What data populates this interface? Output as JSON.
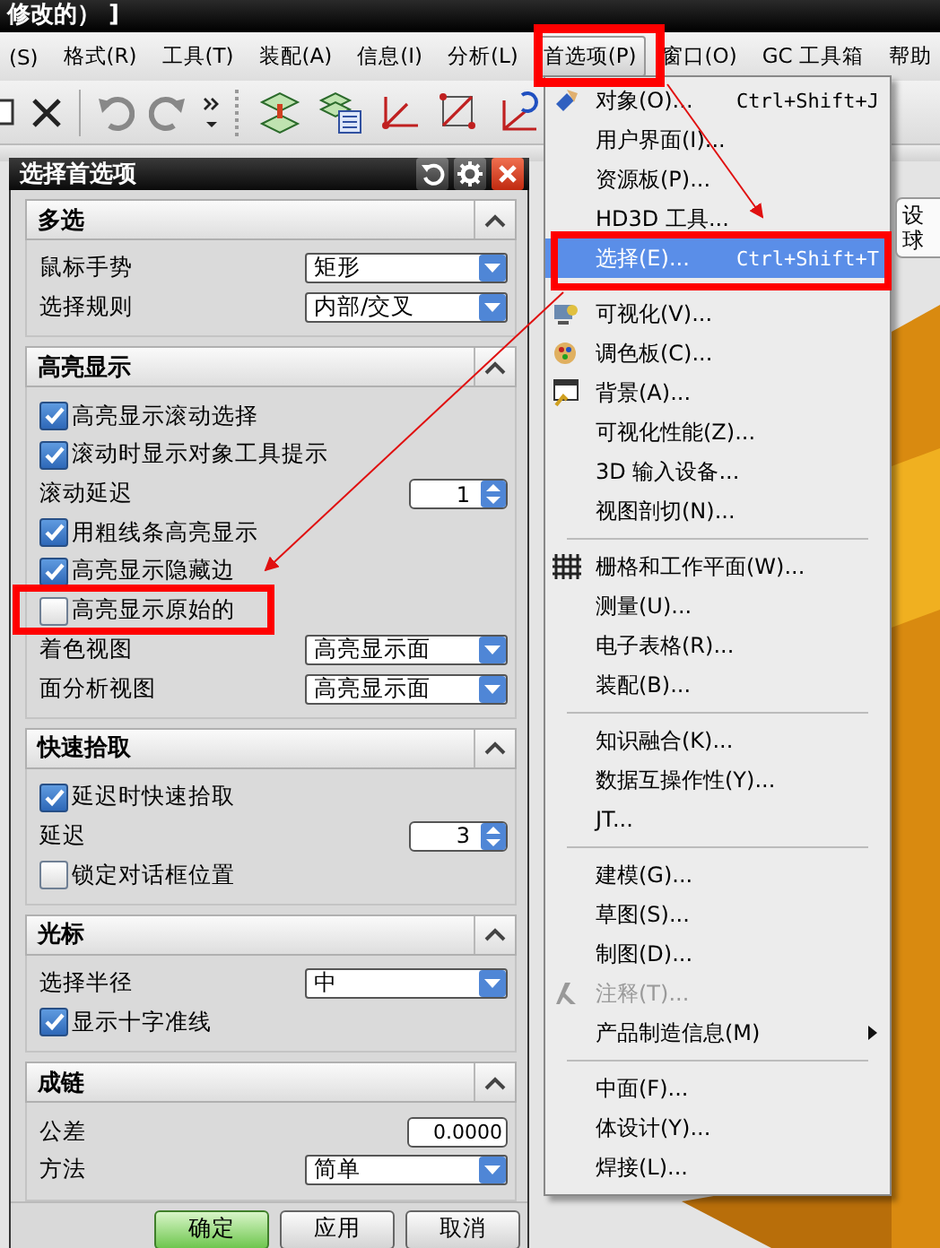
{
  "title_bar": {
    "title": "修改的） ]"
  },
  "menu_bar": [
    {
      "label": "(S)",
      "selected": false
    },
    {
      "label": "格式(R)",
      "selected": false
    },
    {
      "label": "工具(T)",
      "selected": false
    },
    {
      "label": "装配(A)",
      "selected": false
    },
    {
      "label": "信息(I)",
      "selected": false
    },
    {
      "label": "分析(L)",
      "selected": false
    },
    {
      "label": "首选项(P)",
      "selected": true
    },
    {
      "label": "窗口(O)",
      "selected": false
    },
    {
      "label": "GC 工具箱",
      "selected": false
    },
    {
      "label": "帮助",
      "selected": false
    }
  ],
  "dialog": {
    "title": "选择首选项",
    "sections": [
      {
        "title": "多选",
        "rows": [
          {
            "kind": "dropdown",
            "label": "鼠标手势",
            "value": "矩形"
          },
          {
            "kind": "dropdown",
            "label": "选择规则",
            "value": "内部/交叉"
          }
        ]
      },
      {
        "title": "高亮显示",
        "rows": [
          {
            "kind": "checkbox",
            "label": "高亮显示滚动选择",
            "checked": true
          },
          {
            "kind": "checkbox",
            "label": "滚动时显示对象工具提示",
            "checked": true
          },
          {
            "kind": "spinner",
            "label": "滚动延迟",
            "value": "1"
          },
          {
            "kind": "checkbox",
            "label": "用粗线条高亮显示",
            "checked": true
          },
          {
            "kind": "checkbox",
            "label": "高亮显示隐藏边",
            "checked": true
          },
          {
            "kind": "checkbox",
            "label": "高亮显示原始的",
            "checked": false
          },
          {
            "kind": "dropdown",
            "label": "着色视图",
            "value": "高亮显示面"
          },
          {
            "kind": "dropdown",
            "label": "面分析视图",
            "value": "高亮显示面"
          }
        ]
      },
      {
        "title": "快速拾取",
        "rows": [
          {
            "kind": "checkbox",
            "label": "延迟时快速拾取",
            "checked": true
          },
          {
            "kind": "spinner",
            "label": "延迟",
            "value": "3"
          },
          {
            "kind": "checkbox",
            "label": "锁定对话框位置",
            "checked": false
          }
        ]
      },
      {
        "title": "光标",
        "rows": [
          {
            "kind": "dropdown",
            "label": "选择半径",
            "value": "中"
          },
          {
            "kind": "checkbox",
            "label": "显示十字准线",
            "checked": true
          }
        ]
      },
      {
        "title": "成链",
        "rows": [
          {
            "kind": "number",
            "label": "公差",
            "value": "0.0000"
          },
          {
            "kind": "dropdown",
            "label": "方法",
            "value": "简单"
          }
        ]
      }
    ],
    "buttons": [
      {
        "label": "确定",
        "primary": true
      },
      {
        "label": "应用",
        "primary": false
      },
      {
        "label": "取消",
        "primary": false
      }
    ]
  },
  "menu": {
    "items": [
      {
        "kind": "item",
        "label": "对象(O)...",
        "shortcut": "Ctrl+Shift+J",
        "selected": false,
        "disabled": false
      },
      {
        "kind": "item",
        "label": "用户界面(I)...",
        "selected": false,
        "disabled": false
      },
      {
        "kind": "item",
        "label": "资源板(P)...",
        "selected": false,
        "disabled": false
      },
      {
        "kind": "item",
        "label": "HD3D 工具...",
        "selected": false,
        "disabled": false
      },
      {
        "kind": "item",
        "label": "选择(E)...",
        "shortcut": "Ctrl+Shift+T",
        "selected": true,
        "disabled": false
      },
      {
        "kind": "separator"
      },
      {
        "kind": "item",
        "label": "可视化(V)...",
        "selected": false,
        "disabled": false
      },
      {
        "kind": "item",
        "label": "调色板(C)...",
        "selected": false,
        "disabled": false
      },
      {
        "kind": "item",
        "label": "背景(A)...",
        "selected": false,
        "disabled": false
      },
      {
        "kind": "item",
        "label": "可视化性能(Z)...",
        "selected": false,
        "disabled": false
      },
      {
        "kind": "item",
        "label": "3D 输入设备...",
        "selected": false,
        "disabled": false
      },
      {
        "kind": "item",
        "label": "视图剖切(N)...",
        "selected": false,
        "disabled": false
      },
      {
        "kind": "separator"
      },
      {
        "kind": "item",
        "label": "栅格和工作平面(W)...",
        "selected": false,
        "disabled": false
      },
      {
        "kind": "item",
        "label": "测量(U)...",
        "selected": false,
        "disabled": false
      },
      {
        "kind": "item",
        "label": "电子表格(R)...",
        "selected": false,
        "disabled": false
      },
      {
        "kind": "item",
        "label": "装配(B)...",
        "selected": false,
        "disabled": false
      },
      {
        "kind": "separator"
      },
      {
        "kind": "item",
        "label": "知识融合(K)...",
        "selected": false,
        "disabled": false
      },
      {
        "kind": "item",
        "label": "数据互操作性(Y)...",
        "selected": false,
        "disabled": false
      },
      {
        "kind": "item",
        "label": "JT...",
        "selected": false,
        "disabled": false
      },
      {
        "kind": "separator"
      },
      {
        "kind": "item",
        "label": "建模(G)...",
        "selected": false,
        "disabled": false
      },
      {
        "kind": "item",
        "label": "草图(S)...",
        "selected": false,
        "disabled": false
      },
      {
        "kind": "item",
        "label": "制图(D)...",
        "selected": false,
        "disabled": false
      },
      {
        "kind": "item",
        "label": "注释(T)...",
        "selected": false,
        "disabled": true
      },
      {
        "kind": "submenu",
        "label": "产品制造信息(M)",
        "selected": false,
        "disabled": false
      },
      {
        "kind": "separator"
      },
      {
        "kind": "item",
        "label": "中面(F)...",
        "selected": false,
        "disabled": false
      },
      {
        "kind": "item",
        "label": "体设计(Y)...",
        "selected": false,
        "disabled": false
      },
      {
        "kind": "item",
        "label": "焊接(L)...",
        "selected": false,
        "disabled": false
      }
    ]
  },
  "tooltip": {
    "lines": [
      "设",
      "球"
    ]
  }
}
